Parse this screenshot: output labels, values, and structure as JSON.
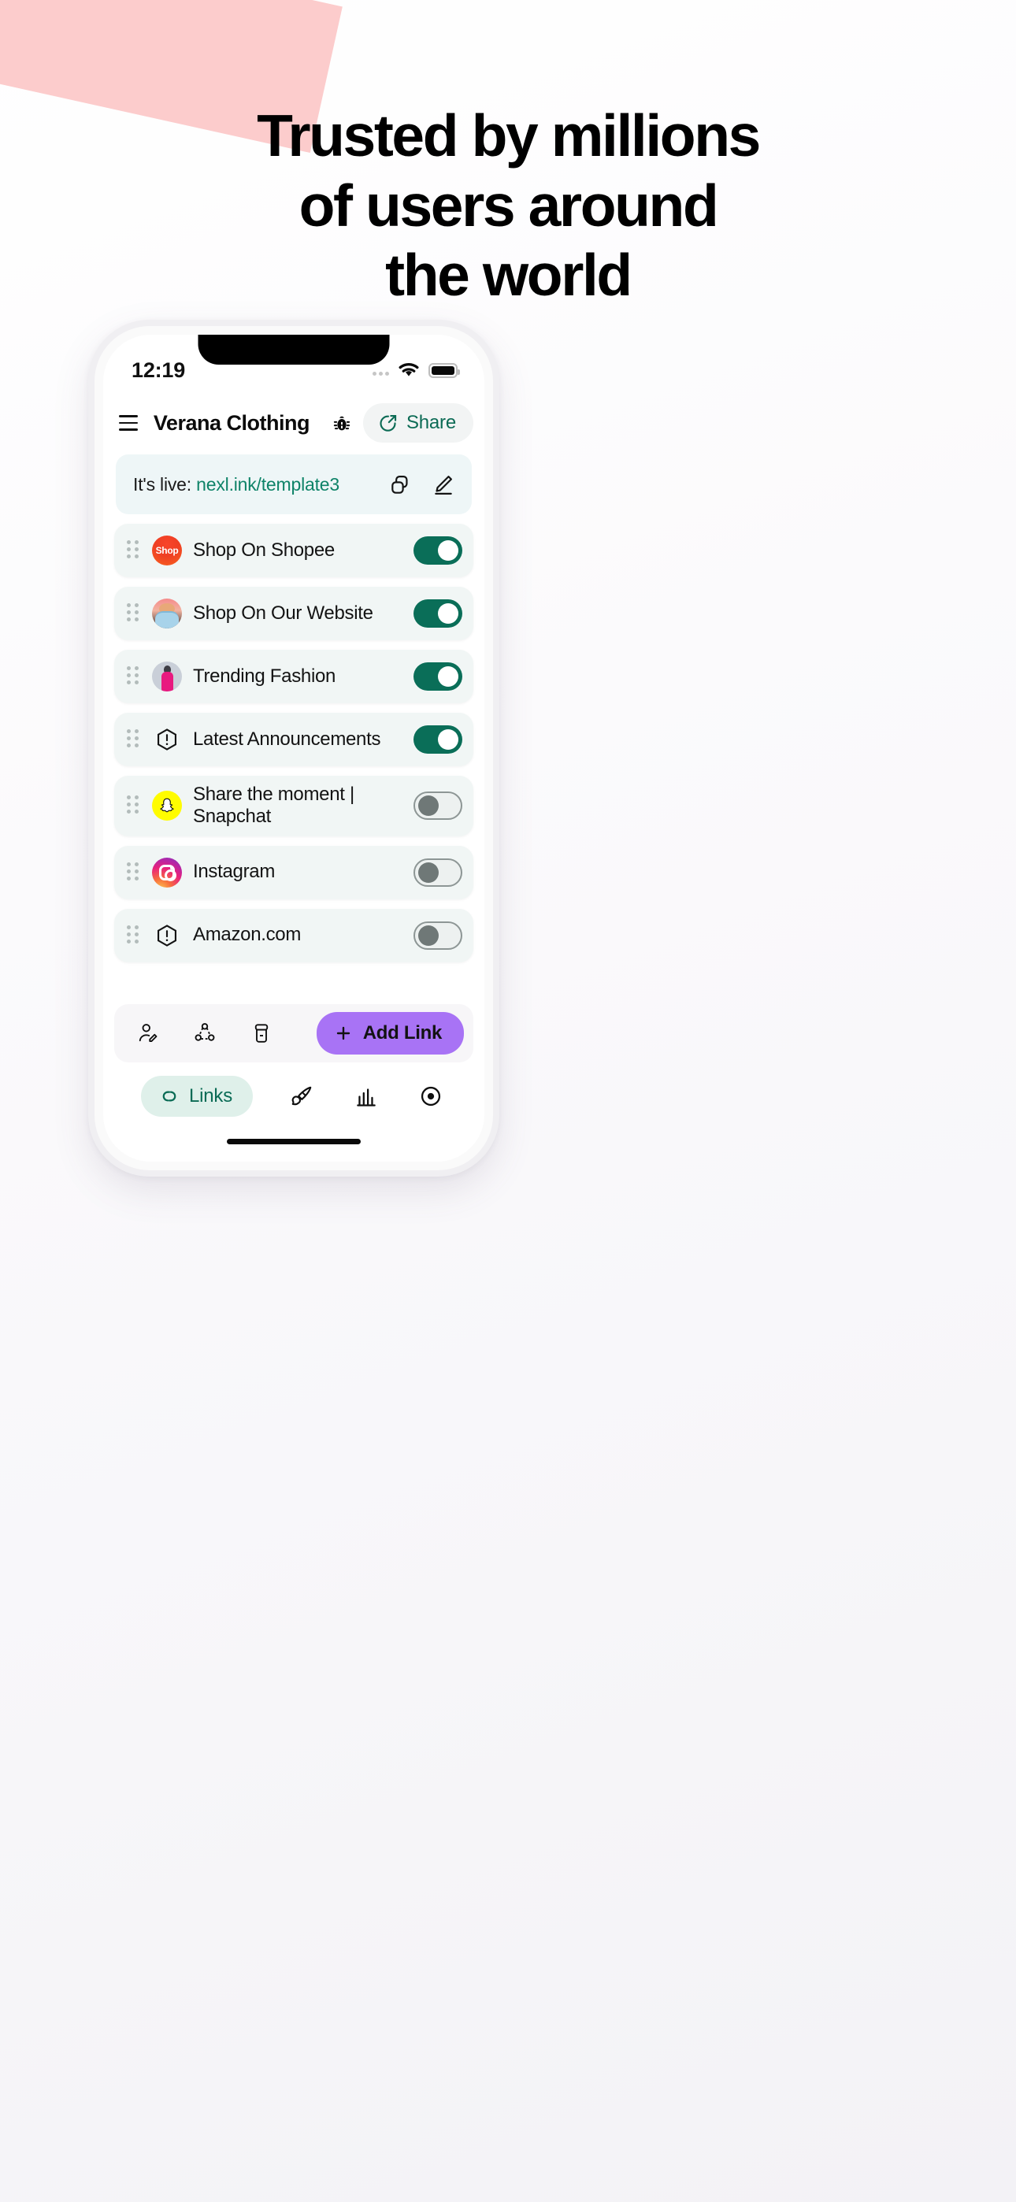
{
  "headline": {
    "line1": "Trusted by millions",
    "line2": "of users around",
    "line3": "the world"
  },
  "colors": {
    "accent_green": "#0a6e58",
    "link_green": "#0e8368",
    "add_link_purple": "#a873f5",
    "pink_streak": "#fccccc",
    "row_bg": "#f1f6f5",
    "banner_bg": "#eef6f7"
  },
  "phone": {
    "status_bar": {
      "time": "12:19",
      "wifi_icon": "wifi-icon",
      "battery_icon": "battery-full-icon",
      "signal_dots_icon": "signal-dots-icon"
    },
    "header": {
      "menu_icon": "hamburger-menu-icon",
      "title": "Verana Clothing",
      "bug_icon": "bug-icon",
      "share_icon": "share-arrow-icon",
      "share_label": "Share"
    },
    "live_banner": {
      "prefix": "It's live:",
      "url": "nexl.ink/template3",
      "copy_icon": "copy-icon",
      "edit_icon": "pencil-edit-icon"
    },
    "links": [
      {
        "label": "Shop On Shopee",
        "icon": "shopee-logo-icon",
        "icon_text": "Shop",
        "icon_class": "ico-shopee",
        "enabled": true,
        "drag_icon": "drag-handle-icon"
      },
      {
        "label": "Shop On Our Website",
        "icon": "website-thumbnail-icon",
        "icon_text": "",
        "icon_class": "ico-website",
        "enabled": true,
        "drag_icon": "drag-handle-icon"
      },
      {
        "label": "Trending Fashion",
        "icon": "fashion-thumbnail-icon",
        "icon_text": "",
        "icon_class": "ico-fashion",
        "enabled": true,
        "drag_icon": "drag-handle-icon"
      },
      {
        "label": "Latest Announcements",
        "icon": "alert-hexagon-icon",
        "icon_text": "",
        "icon_class": "ico-generic",
        "enabled": true,
        "drag_icon": "drag-handle-icon"
      },
      {
        "label": "Share the moment |",
        "label2": "Snapchat",
        "icon": "snapchat-logo-icon",
        "icon_text": "",
        "icon_class": "ico-snap",
        "enabled": false,
        "drag_icon": "drag-handle-icon"
      },
      {
        "label": "Instagram",
        "icon": "instagram-logo-icon",
        "icon_text": "",
        "icon_class": "ico-insta",
        "enabled": false,
        "drag_icon": "drag-handle-icon"
      },
      {
        "label": "Amazon.com",
        "icon": "alert-hexagon-icon",
        "icon_text": "",
        "icon_class": "ico-generic",
        "enabled": false,
        "drag_icon": "drag-handle-icon"
      }
    ],
    "toolbar": {
      "profile_edit_icon": "user-edit-icon",
      "socials_icon": "social-network-icon",
      "archive_icon": "archive-box-icon",
      "add_icon": "plus-icon",
      "add_label": "Add Link"
    },
    "bottom_nav": {
      "links_icon": "links-chain-icon",
      "links_label": "Links",
      "design_icon": "paintbrush-icon",
      "analytics_icon": "bar-chart-icon",
      "preview_icon": "eye-target-icon"
    }
  }
}
